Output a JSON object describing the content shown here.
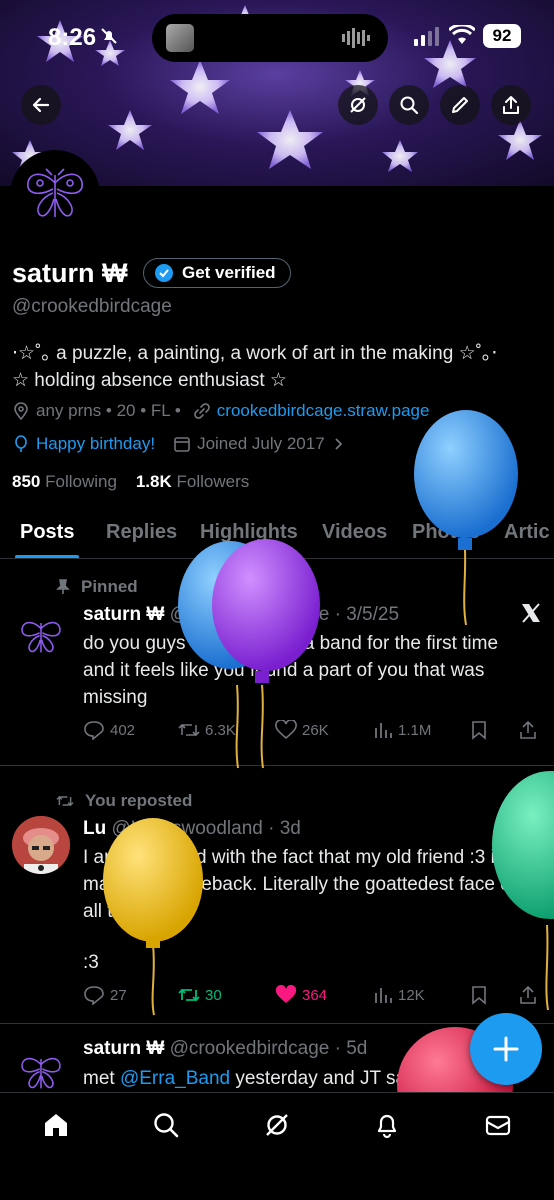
{
  "status_bar": {
    "time": "8:26",
    "battery": "92"
  },
  "profile": {
    "name": "saturn ₩",
    "verify_label": "Get verified",
    "handle": "@crookedbirdcage",
    "bio_line1": "⋅☆˚｡ a puzzle, a painting, a work of art in the making ☆˚｡⋅",
    "bio_line2": "☆ holding absence enthusiast ☆",
    "location": "any prns • 20 • FL •",
    "website": "crookedbirdcage.straw.page",
    "birthday": "Happy birthday!",
    "joined": "Joined July 2017",
    "following_count": "850",
    "following_label": "Following",
    "followers_count": "1.8K",
    "followers_label": "Followers"
  },
  "tabs": [
    "Posts",
    "Replies",
    "Highlights",
    "Videos",
    "Photos",
    "Artic"
  ],
  "tweets": [
    {
      "context": "Pinned",
      "name": "saturn ₩",
      "handle_date": "@crookedbirdcage · 3/5/25",
      "text": "do you guys ever listen to a band for the first time and it feels like you found a part of you that was missing",
      "replies": "402",
      "retweets": "6.3K",
      "likes": "26K",
      "views": "1.1M"
    },
    {
      "context": "You reposted",
      "name": "Lu",
      "handle_date": "@Lucaswoodland · 3d",
      "text": "I am obsessed with the fact that my old friend :3 is making a comeback. Literally the goattedest face of all time",
      "text2": ":3",
      "replies": "27",
      "retweets": "30",
      "likes": "364",
      "views": "12K"
    },
    {
      "name": "saturn ₩",
      "handle_date": "@crookedbirdcage · 5d",
      "text_pre": "met ",
      "mention": "@Erra_Band",
      "text_post": " yesterday and JT said he liked"
    }
  ],
  "colors": {
    "accent": "#1d9bf0",
    "like": "#f91880",
    "retweet": "#00ba7c",
    "muted": "#71767b"
  }
}
